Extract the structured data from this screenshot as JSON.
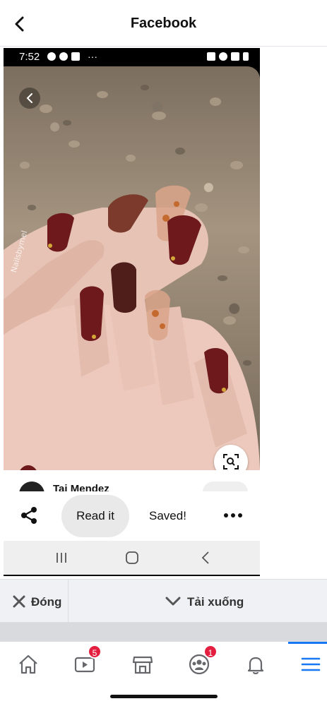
{
  "header": {
    "title": "Facebook"
  },
  "phone": {
    "status": {
      "time": "7:52"
    },
    "photo": {
      "watermark": "Nailsbymel"
    },
    "pin": {
      "author": "Tai Mendez"
    },
    "actions": {
      "read_label": "Read it",
      "saved_label": "Saved!"
    }
  },
  "download_bar": {
    "close_label": "Đóng",
    "download_label": "Tải xuống"
  },
  "tabs": [
    {
      "name": "home"
    },
    {
      "name": "watch",
      "badge": "5"
    },
    {
      "name": "marketplace"
    },
    {
      "name": "groups",
      "badge": "1"
    },
    {
      "name": "notifications"
    },
    {
      "name": "menu"
    }
  ],
  "colors": {
    "accent": "#1877f2",
    "badge": "#e41e3f",
    "nail_dark": "#6e1a1c"
  }
}
